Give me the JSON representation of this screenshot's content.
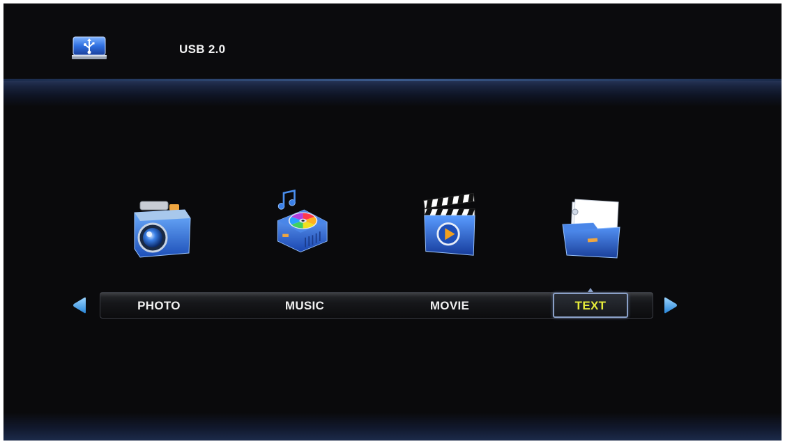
{
  "header": {
    "source_label": "USB 2.0",
    "source_icon": "usb-drive-icon"
  },
  "menu": {
    "items": [
      {
        "label": "PHOTO",
        "icon": "camera-icon",
        "selected": false
      },
      {
        "label": "MUSIC",
        "icon": "music-disc-icon",
        "selected": false
      },
      {
        "label": "MOVIE",
        "icon": "clapperboard-icon",
        "selected": false
      },
      {
        "label": "TEXT",
        "icon": "document-folder-icon",
        "selected": true
      }
    ],
    "selected_text_color": "#e6ec3a",
    "label_color": "#f0f0f0",
    "arrow_color": "#4aa6e6",
    "left_arrow_icon": "arrow-left-icon",
    "right_arrow_icon": "arrow-right-icon"
  },
  "colors": {
    "background": "#0a0a0c",
    "accent_blue": "#3a6fd8",
    "highlight_border": "#8aa0c8"
  }
}
